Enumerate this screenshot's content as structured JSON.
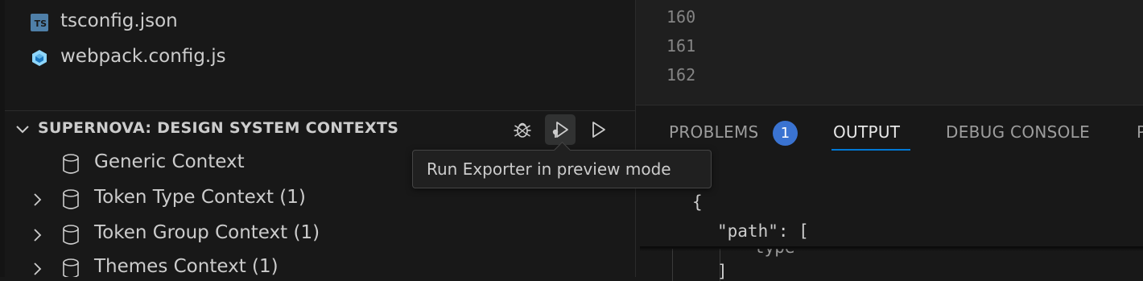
{
  "explorer": {
    "files": [
      {
        "name": "tsconfig.json",
        "icon": "typescript-config-icon"
      },
      {
        "name": "webpack.config.js",
        "icon": "webpack-icon"
      }
    ],
    "ts_badge": "TS",
    "section": {
      "title": "SUPERNOVA: DESIGN SYSTEM CONTEXTS",
      "actions": [
        {
          "name": "debug-exporter-button",
          "icon": "bug-icon"
        },
        {
          "name": "run-exporter-preview-button",
          "icon": "run-preview-icon"
        },
        {
          "name": "run-exporter-button",
          "icon": "play-icon"
        }
      ],
      "items": [
        {
          "label": "Generic Context",
          "expandable": false
        },
        {
          "label": "Token Type Context (1)",
          "expandable": true
        },
        {
          "label": "Token Group Context (1)",
          "expandable": true
        },
        {
          "label": "Themes Context (1)",
          "expandable": true
        }
      ]
    }
  },
  "tooltip": {
    "text": "Run Exporter in preview mode"
  },
  "editor": {
    "line_numbers": [
      "160",
      "161",
      "162"
    ]
  },
  "panel": {
    "tabs": [
      {
        "label": "PROBLEMS",
        "badge": "1",
        "active": false
      },
      {
        "label": "OUTPUT",
        "active": true
      },
      {
        "label": "DEBUG CONSOLE",
        "active": false
      },
      {
        "label": "P",
        "active": false
      }
    ],
    "code_lines": [
      "{",
      "\"path\": [",
      "type",
      "]"
    ]
  },
  "colors": {
    "accent": "#0078d4",
    "badge": "#3a73d1",
    "ts_icon": "#4f7fa8",
    "webpack_icon": "#8ed6fb",
    "background": "#181818"
  }
}
